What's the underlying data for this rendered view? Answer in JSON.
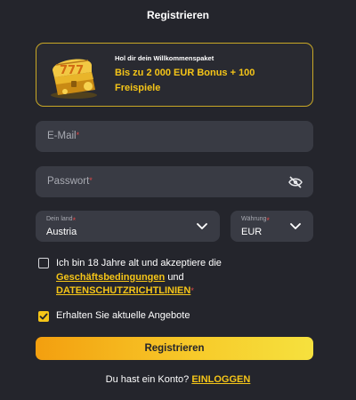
{
  "title": "Registrieren",
  "promo": {
    "small_text": "Hol dir dein Willkommenspaket",
    "bonus_text": "Bis zu 2 000 EUR Bonus + 100 Freispiele"
  },
  "form": {
    "email_placeholder": "E-Mail",
    "password_placeholder": "Passwort",
    "required_mark": "*",
    "country": {
      "label": "Dein land",
      "value": "Austria"
    },
    "currency": {
      "label": "Währung",
      "value": "EUR"
    },
    "terms": {
      "prefix": "Ich bin 18 Jahre alt und akzeptiere die",
      "link1": "Geschäftsbedingungen",
      "middle": "und",
      "link2": "DATENSCHUTZRICHTLINIEN",
      "checked": false
    },
    "offers": {
      "label": "Erhalten Sie aktuelle Angebote",
      "checked": true
    },
    "submit_label": "Registrieren"
  },
  "footer": {
    "question": "Du hast ein Konto?",
    "login_link": "EINLOGGEN"
  },
  "colors": {
    "background": "#24252c",
    "field": "#393b44",
    "accent": "#f5c518",
    "required": "#e04848"
  },
  "icons": {
    "promo": "treasure-chest-icon",
    "password_toggle": "eye-slash-icon",
    "dropdown": "chevron-down-icon",
    "checkbox_checked": "checkmark-icon"
  }
}
